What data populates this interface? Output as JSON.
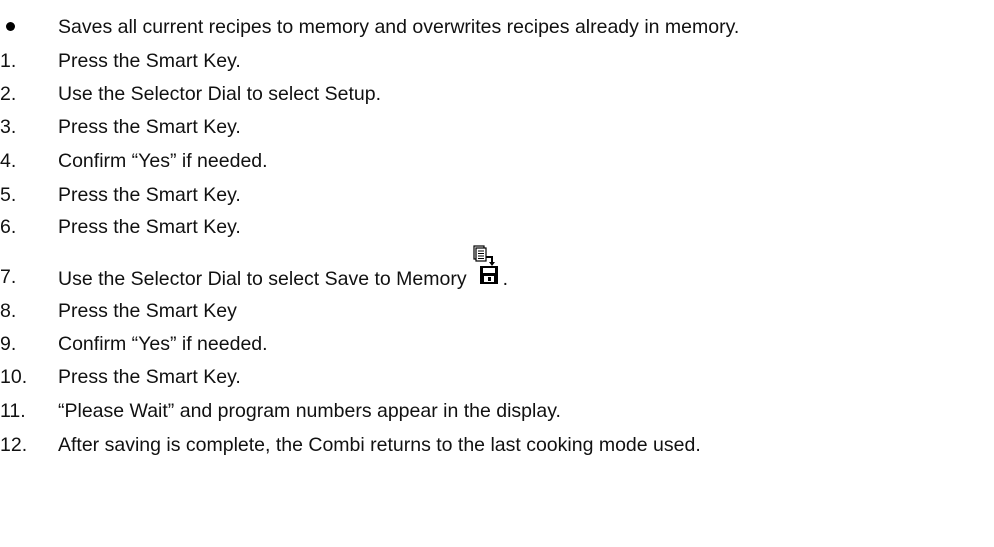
{
  "bullet": {
    "text": "Saves all current recipes to memory and overwrites recipes already in memory."
  },
  "steps": [
    {
      "number": "1.",
      "text": "Press the Smart Key."
    },
    {
      "number": "2.",
      "text": "Use the Selector Dial to select Setup."
    },
    {
      "number": "3.",
      "text": "Press the Smart Key."
    },
    {
      "number": "4.",
      "text": "Confirm “Yes” if needed."
    },
    {
      "number": "5.",
      "text": "Press the Smart Key."
    },
    {
      "number": "6.",
      "text": "Press the Smart Key."
    },
    {
      "number": "7.",
      "text": "Use the Selector Dial to select Save to Memory",
      "suffix": "."
    },
    {
      "number": "8.",
      "text": "Press the Smart Key"
    },
    {
      "number": "9.",
      "text": "Confirm “Yes” if needed."
    },
    {
      "number": "10.",
      "text": "Press the Smart Key."
    },
    {
      "number": "11.",
      "text": "“Please Wait” and program numbers appear in the display."
    },
    {
      "number": "12.",
      "text": "After saving is complete, the Combi returns to the last cooking mode used."
    }
  ],
  "icons": {
    "save_to_memory": "save-to-memory-icon"
  }
}
